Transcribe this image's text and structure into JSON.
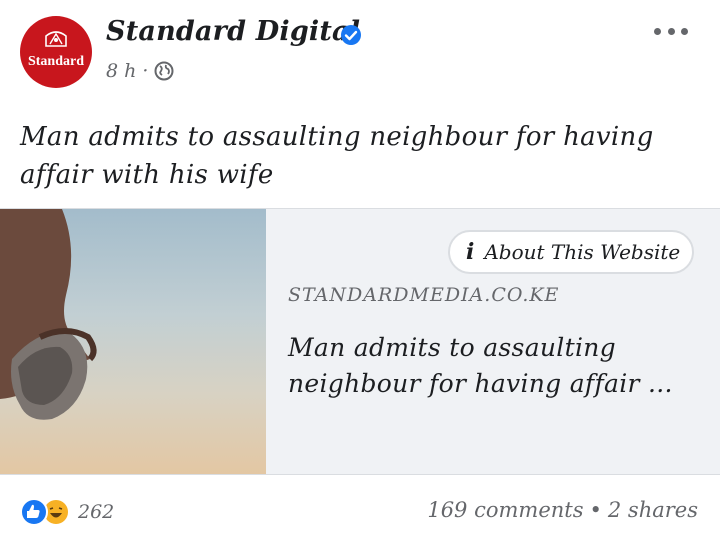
{
  "post": {
    "page_name": "Standard Digital",
    "avatar_text": "Standard",
    "time": "8 h",
    "separator": "·",
    "text": "Man admits to assaulting neighbour for having affair with his wife"
  },
  "link_card": {
    "about_label": "About This Website",
    "domain": "STANDARDMEDIA.CO.KE",
    "title": "Man admits to assaulting neighbour for having affair ..."
  },
  "footer": {
    "reaction_count": "262",
    "comments": "169 comments",
    "dot": "•",
    "shares": "2 shares"
  },
  "colors": {
    "brand_red": "#c8161d",
    "verified_blue": "#1877f2",
    "muted": "#65676b",
    "card_bg": "#f0f2f5"
  },
  "icons": [
    "verified-badge-icon",
    "globe-icon",
    "more-options-icon",
    "info-icon",
    "like-reaction-icon",
    "haha-reaction-icon"
  ]
}
